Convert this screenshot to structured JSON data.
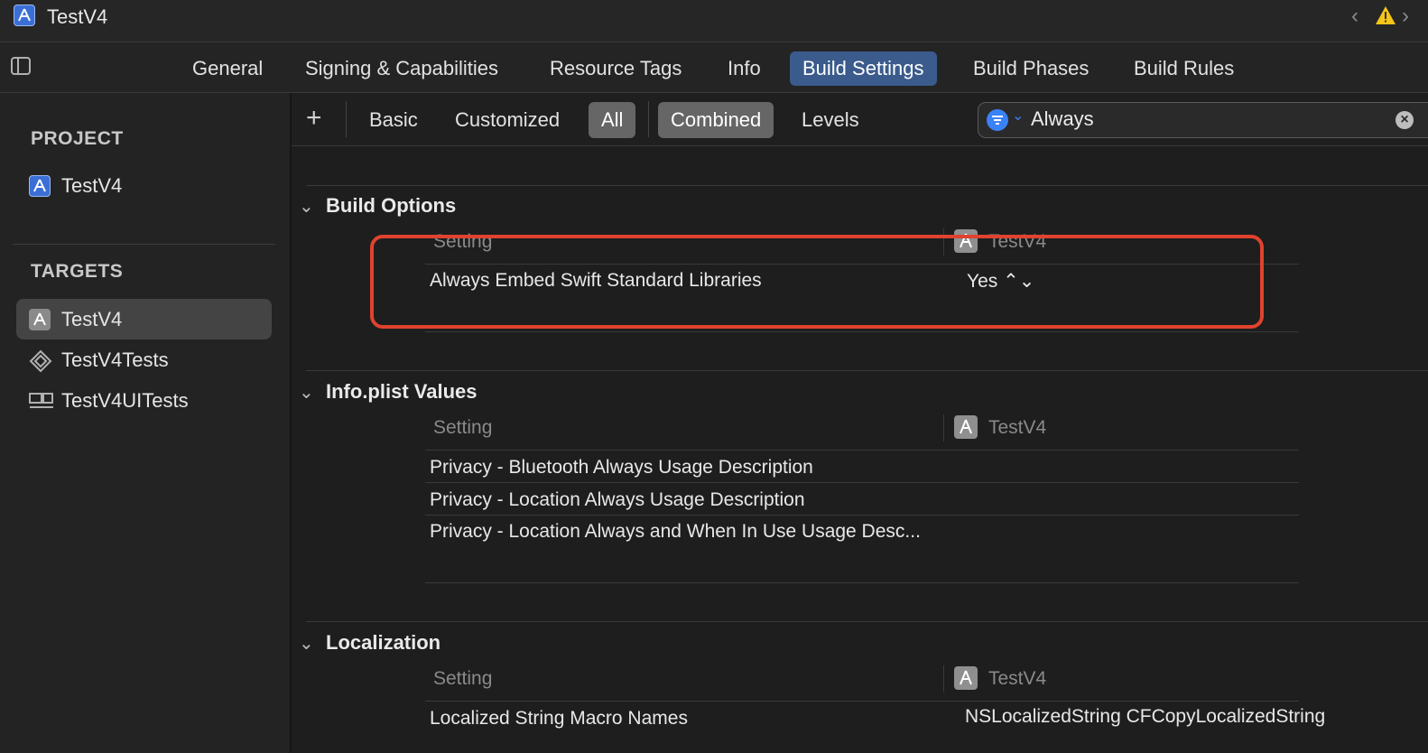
{
  "window": {
    "title": "TestV4",
    "nav_back": "‹",
    "nav_forward": "›"
  },
  "tabs": [
    {
      "label": "General"
    },
    {
      "label": "Signing & Capabilities"
    },
    {
      "label": "Resource Tags"
    },
    {
      "label": "Info"
    },
    {
      "label": "Build Settings",
      "active": true
    },
    {
      "label": "Build Phases"
    },
    {
      "label": "Build Rules"
    }
  ],
  "sidebar": {
    "project_header": "PROJECT",
    "project_item": "TestV4",
    "targets_header": "TARGETS",
    "targets": [
      {
        "label": "TestV4",
        "icon": "app-target-icon",
        "selected": true
      },
      {
        "label": "TestV4Tests",
        "icon": "unit-tests-icon"
      },
      {
        "label": "TestV4UITests",
        "icon": "ui-tests-icon"
      }
    ]
  },
  "filterbar": {
    "add_label": "+",
    "segments_level": [
      "Basic",
      "Customized",
      "All"
    ],
    "active_level": "All",
    "segments_view": [
      "Combined",
      "Levels"
    ],
    "active_view": "Combined",
    "search_value": "Always",
    "clear_label": "×"
  },
  "sections": [
    {
      "title": "Build Options",
      "col_setting": "Setting",
      "col_target": "TestV4",
      "rows": [
        {
          "setting": "Always Embed Swift Standard Libraries",
          "value": "Yes ⌃⌄"
        }
      ]
    },
    {
      "title": "Info.plist Values",
      "col_setting": "Setting",
      "col_target": "TestV4",
      "rows": [
        {
          "setting": "Privacy - Bluetooth Always Usage Description",
          "value": ""
        },
        {
          "setting": "Privacy - Location Always Usage Description",
          "value": ""
        },
        {
          "setting": "Privacy - Location Always and When In Use Usage Desc...",
          "value": ""
        }
      ]
    },
    {
      "title": "Localization",
      "col_setting": "Setting",
      "col_target": "TestV4",
      "rows": [
        {
          "setting": "Localized String Macro Names",
          "value": "NSLocalizedString CFCopyLocalizedString"
        }
      ]
    }
  ],
  "colors": {
    "accent": "#3a82f7",
    "tab_active": "#3a5b8c",
    "highlight": "#e0422f",
    "warning": "#f5c518"
  }
}
